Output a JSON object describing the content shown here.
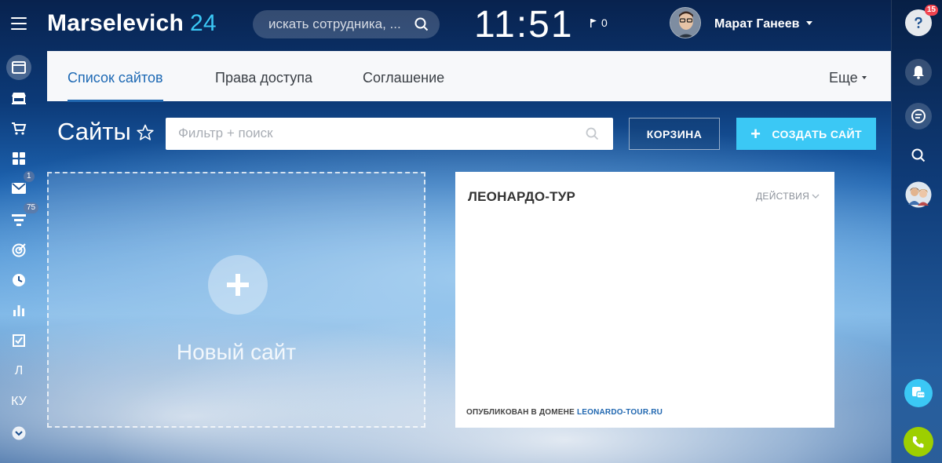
{
  "header": {
    "logo_main": "Marselevich",
    "logo_num": "24",
    "search_placeholder": "искать сотрудника, ...",
    "clock": "11:51",
    "flag_count": "0",
    "user_name": "Марат Ганеев"
  },
  "left_sidebar": {
    "items": [
      {
        "icon": "browser-icon"
      },
      {
        "icon": "store-icon"
      },
      {
        "icon": "cart-icon"
      },
      {
        "icon": "grid-icon"
      },
      {
        "icon": "mail-icon",
        "badge": "1"
      },
      {
        "icon": "filter-icon",
        "badge": "75"
      },
      {
        "icon": "target-icon"
      },
      {
        "icon": "clock-icon"
      },
      {
        "icon": "chart-icon"
      },
      {
        "icon": "checkbox-icon"
      },
      {
        "icon": "text-item",
        "label": "Л"
      },
      {
        "icon": "text-item",
        "label": "КУ"
      },
      {
        "icon": "chevron-down-icon"
      }
    ]
  },
  "right_sidebar": {
    "help_badge": "15"
  },
  "tabs": {
    "items": [
      "Список сайтов",
      "Права доступа",
      "Соглашение"
    ],
    "more": "Еще"
  },
  "page": {
    "title": "Сайты",
    "filter_placeholder": "Фильтр + поиск",
    "btn_trash": "КОРЗИНА",
    "btn_create": "СОЗДАТЬ САЙТ"
  },
  "new_site": {
    "label": "Новый сайт"
  },
  "site_card": {
    "name": "ЛЕОНАРДО-ТУР",
    "actions": "ДЕЙСТВИЯ",
    "published_prefix": "ОПУБЛИКОВАН В ДОМЕНЕ",
    "domain": "LEONARDO-TOUR.RU"
  },
  "colors": {
    "accent": "#3bc8f5",
    "link": "#2067b0",
    "badge": "#f0444f",
    "call": "#9dcf00"
  }
}
